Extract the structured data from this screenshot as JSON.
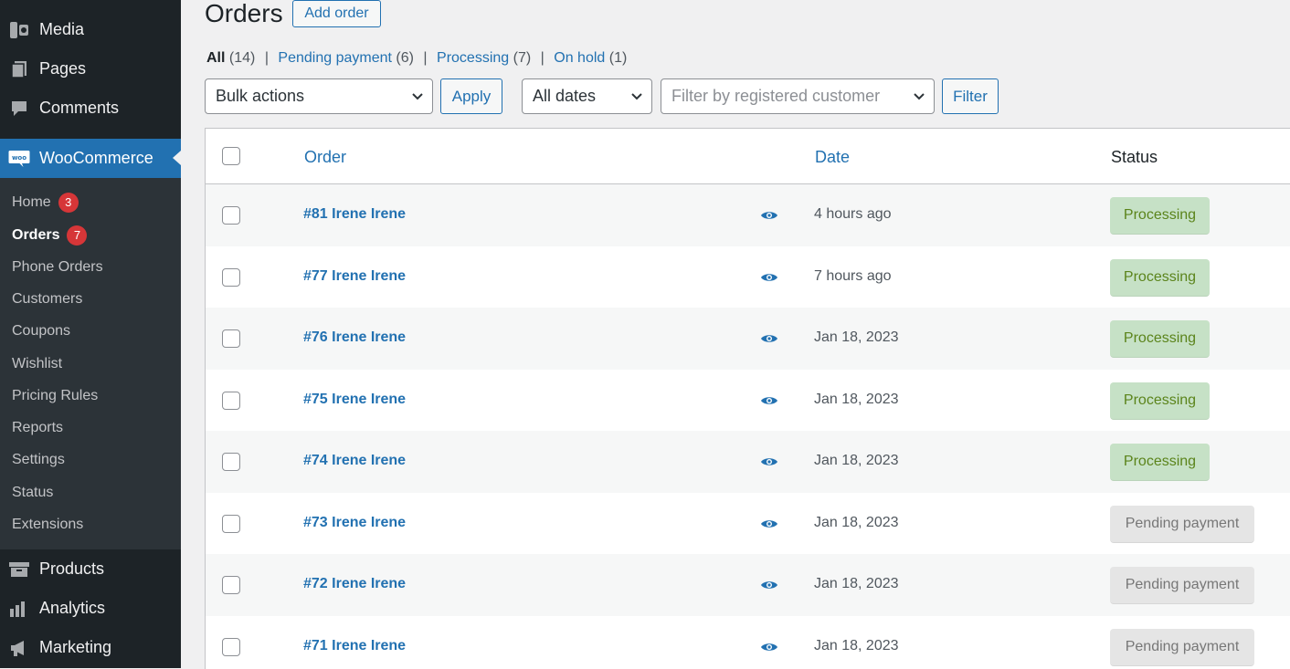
{
  "sidebar": {
    "top_items": [
      {
        "label": "Media",
        "icon": "media-icon"
      },
      {
        "label": "Pages",
        "icon": "pages-icon"
      },
      {
        "label": "Comments",
        "icon": "comments-icon"
      }
    ],
    "woocommerce": {
      "label": "WooCommerce",
      "icon": "woocommerce-logo-icon"
    },
    "submenu": [
      {
        "label": "Home",
        "badge": "3"
      },
      {
        "label": "Orders",
        "badge": "7",
        "current": true
      },
      {
        "label": "Phone Orders"
      },
      {
        "label": "Customers"
      },
      {
        "label": "Coupons"
      },
      {
        "label": "Wishlist"
      },
      {
        "label": "Pricing Rules"
      },
      {
        "label": "Reports"
      },
      {
        "label": "Settings"
      },
      {
        "label": "Status"
      },
      {
        "label": "Extensions"
      }
    ],
    "bottom_items": [
      {
        "label": "Products",
        "icon": "products-icon"
      },
      {
        "label": "Analytics",
        "icon": "analytics-icon"
      },
      {
        "label": "Marketing",
        "icon": "marketing-icon"
      }
    ]
  },
  "header": {
    "title": "Orders",
    "add_order_label": "Add order"
  },
  "views": {
    "all": {
      "label": "All",
      "count": "(14)"
    },
    "pending": {
      "label": "Pending payment",
      "count": "(6)"
    },
    "processing": {
      "label": "Processing",
      "count": "(7)"
    },
    "onhold": {
      "label": "On hold",
      "count": "(1)"
    },
    "separator": "|"
  },
  "filters": {
    "bulk_actions": "Bulk actions",
    "apply_label": "Apply",
    "dates": "All dates",
    "customer_placeholder": "Filter by registered customer",
    "filter_label": "Filter"
  },
  "table": {
    "columns": {
      "order": "Order",
      "date": "Date",
      "status": "Status"
    },
    "rows": [
      {
        "order": "#81 Irene Irene",
        "date": "4 hours ago",
        "status": "Processing",
        "status_type": "processing"
      },
      {
        "order": "#77 Irene Irene",
        "date": "7 hours ago",
        "status": "Processing",
        "status_type": "processing"
      },
      {
        "order": "#76 Irene Irene",
        "date": "Jan 18, 2023",
        "status": "Processing",
        "status_type": "processing"
      },
      {
        "order": "#75 Irene Irene",
        "date": "Jan 18, 2023",
        "status": "Processing",
        "status_type": "processing"
      },
      {
        "order": "#74 Irene Irene",
        "date": "Jan 18, 2023",
        "status": "Processing",
        "status_type": "processing"
      },
      {
        "order": "#73 Irene Irene",
        "date": "Jan 18, 2023",
        "status": "Pending payment",
        "status_type": "pending"
      },
      {
        "order": "#72 Irene Irene",
        "date": "Jan 18, 2023",
        "status": "Pending payment",
        "status_type": "pending"
      },
      {
        "order": "#71 Irene Irene",
        "date": "Jan 18, 2023",
        "status": "Pending payment",
        "status_type": "pending"
      }
    ]
  },
  "colors": {
    "sidebar_bg": "#1d2327",
    "submenu_bg": "#2c3338",
    "accent": "#2271b1",
    "badge": "#d63638",
    "processing_bg": "#c6e1c6",
    "processing_text": "#5b841b",
    "pending_bg": "#e5e5e5",
    "pending_text": "#777777"
  }
}
